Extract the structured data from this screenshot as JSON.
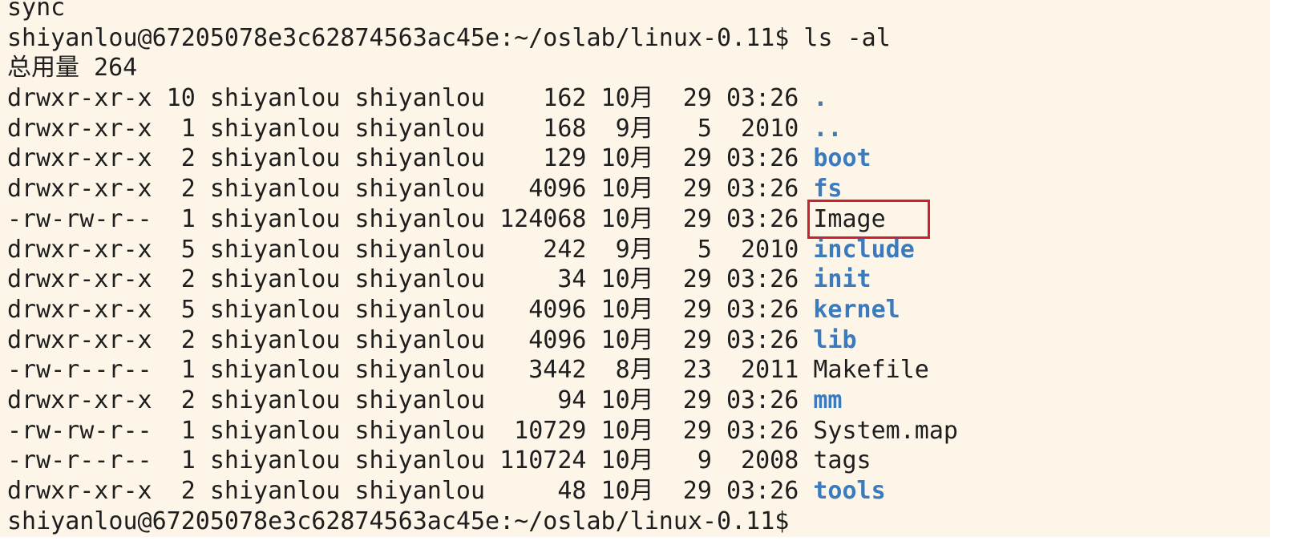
{
  "terminal": {
    "previous_output": "sync",
    "prompt": "shiyanlou@67205078e3c62874563ac45e:~/oslab/linux-0.11$",
    "command": "ls -al",
    "total_line": "总用量 264",
    "entries": [
      {
        "meta": "drwxr-xr-x 10 shiyanlou shiyanlou    162 10月  29 03:26",
        "name": ".",
        "type": "dir"
      },
      {
        "meta": "drwxr-xr-x  1 shiyanlou shiyanlou    168  9月   5  2010",
        "name": "..",
        "type": "dir"
      },
      {
        "meta": "drwxr-xr-x  2 shiyanlou shiyanlou    129 10月  29 03:26",
        "name": "boot",
        "type": "dir"
      },
      {
        "meta": "drwxr-xr-x  2 shiyanlou shiyanlou   4096 10月  29 03:26",
        "name": "fs",
        "type": "dir"
      },
      {
        "meta": "-rw-rw-r--  1 shiyanlou shiyanlou 124068 10月  29 03:26",
        "name": "Image",
        "type": "file",
        "highlighted": true
      },
      {
        "meta": "drwxr-xr-x  5 shiyanlou shiyanlou    242  9月   5  2010",
        "name": "include",
        "type": "dir"
      },
      {
        "meta": "drwxr-xr-x  2 shiyanlou shiyanlou     34 10月  29 03:26",
        "name": "init",
        "type": "dir"
      },
      {
        "meta": "drwxr-xr-x  5 shiyanlou shiyanlou   4096 10月  29 03:26",
        "name": "kernel",
        "type": "dir"
      },
      {
        "meta": "drwxr-xr-x  2 shiyanlou shiyanlou   4096 10月  29 03:26",
        "name": "lib",
        "type": "dir"
      },
      {
        "meta": "-rw-r--r--  1 shiyanlou shiyanlou   3442  8月  23  2011",
        "name": "Makefile",
        "type": "file"
      },
      {
        "meta": "drwxr-xr-x  2 shiyanlou shiyanlou     94 10月  29 03:26",
        "name": "mm",
        "type": "dir"
      },
      {
        "meta": "-rw-rw-r--  1 shiyanlou shiyanlou  10729 10月  29 03:26",
        "name": "System.map",
        "type": "file"
      },
      {
        "meta": "-rw-r--r--  1 shiyanlou shiyanlou 110724 10月   9  2008",
        "name": "tags",
        "type": "file"
      },
      {
        "meta": "drwxr-xr-x  2 shiyanlou shiyanlou     48 10月  29 03:26",
        "name": "tools",
        "type": "dir"
      }
    ],
    "final_prompt": "shiyanlou@67205078e3c62874563ac45e:~/oslab/linux-0.11$"
  },
  "colors": {
    "background": "#fdf6e8",
    "text": "#1e1e1e",
    "directory": "#3b7bbd",
    "highlight_box": "#c8242f"
  }
}
